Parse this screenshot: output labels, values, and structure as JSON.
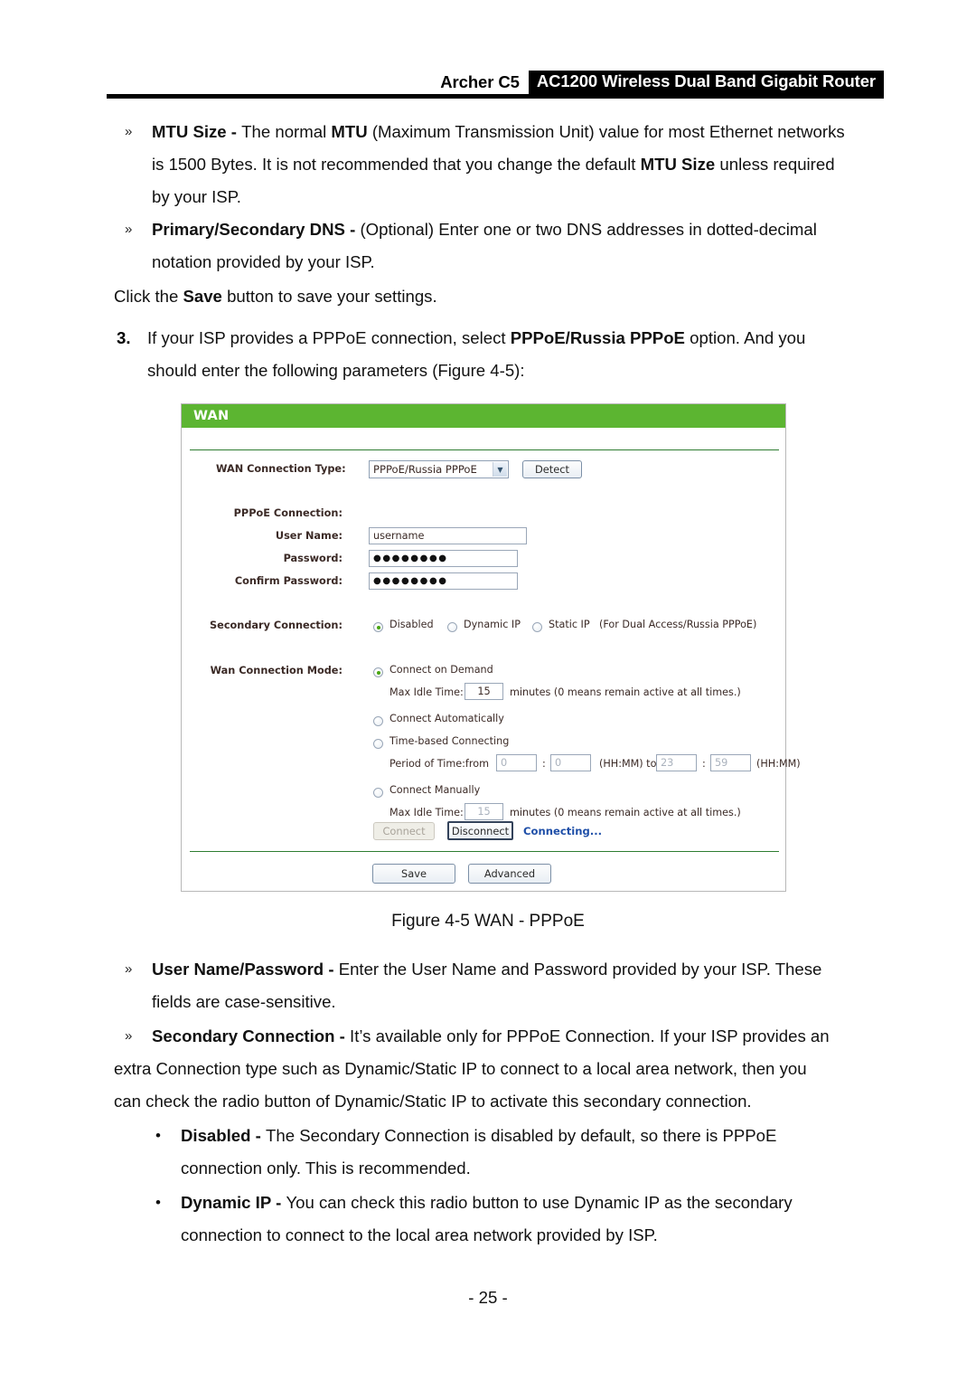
{
  "header": {
    "model": "Archer C5",
    "product": "AC1200 Wireless Dual Band Gigabit Router"
  },
  "body": {
    "b1_marker": "»",
    "b1_l1_a": "MTU Size - ",
    "b1_l1_b": "The normal ",
    "b1_l1_c": "MTU",
    "b1_l1_d": " (Maximum Transmission Unit) value for most Ethernet networks",
    "b1_l2_a": "is 1500 Bytes. It is not recommended that you change the default ",
    "b1_l2_b": "MTU Size",
    "b1_l2_c": " unless required",
    "b1_l3": "by your ISP.",
    "b2_marker": "»",
    "b2_l1_a": "Primary/Secondary DNS - ",
    "b2_l1_b": "(Optional) Enter one or two DNS addresses in dotted-decimal",
    "b2_l2": "notation provided by your ISP.",
    "save_line_a": "Click the ",
    "save_line_b": "Save",
    "save_line_c": " button to save your settings.",
    "n3_marker": "3.",
    "n3_l1_a": "If your ISP provides a PPPoE connection, select ",
    "n3_l1_b": "PPPoE/Russia PPPoE",
    "n3_l1_c": " option. And you",
    "n3_l2": "should enter the following parameters (Figure 4-5):",
    "fig_caption": "Figure 4-5 WAN - PPPoE",
    "b3_marker": "»",
    "b3_l1_a": "User Name/Password - ",
    "b3_l1_b": "Enter the User Name and Password provided by your ISP. These",
    "b3_l2": "fields are case-sensitive.",
    "b4_marker": "»",
    "b4_l1_a": "Secondary Connection - ",
    "b4_l1_b": "It’s available only for PPPoE Connection. If your ISP provides an",
    "b4_l2": "extra Connection type such as Dynamic/Static IP to connect to a local area network, then you",
    "b4_l3": "can check the radio button of Dynamic/Static IP to activate this secondary connection.",
    "b5_marker": "•",
    "b5_l1_a": "Disabled - ",
    "b5_l1_b": "The Secondary Connection is disabled by default, so there is PPPoE",
    "b5_l2": "connection only. This is recommended.",
    "b6_marker": "•",
    "b6_l1_a": "Dynamic IP - ",
    "b6_l1_b": "You can check this radio button to use Dynamic IP as the secondary",
    "b6_l2": "connection to connect to the local area network provided by ISP.",
    "page_number": "- 25 -"
  },
  "wan": {
    "title": "WAN",
    "accent_green": "#5cb531",
    "rule_green": "#2e7d32",
    "link_blue": "#1f4fa8",
    "connection_type_label": "WAN Connection Type:",
    "connection_type_value": "PPPoE/Russia PPPoE",
    "connection_type_caret": "▼",
    "detect_button": "Detect",
    "pppoe_connection_label": "PPPoE Connection:",
    "user_name_label": "User Name:",
    "user_name_value": "username",
    "password_label": "Password:",
    "password_value": "●●●●●●●●",
    "confirm_password_label": "Confirm Password:",
    "confirm_password_value": "●●●●●●●●",
    "secondary_connection_label": "Secondary Connection:",
    "secondary_options": [
      {
        "label": "Disabled",
        "selected": true
      },
      {
        "label": "Dynamic IP",
        "selected": false
      },
      {
        "label": "Static IP",
        "selected": false
      }
    ],
    "secondary_note": "(For Dual Access/Russia PPPoE)",
    "wan_mode_label": "Wan Connection Mode:",
    "mode_demand": "Connect on Demand",
    "max_idle_label_1": "Max Idle Time:",
    "max_idle_value_1": "15",
    "max_idle_units_1": "minutes (0 means remain active at all times.)",
    "mode_auto": "Connect Automatically",
    "mode_time_based": "Time-based Connecting",
    "period_label": "Period of Time:from",
    "period_from_hh": "0",
    "period_colon_1": ":",
    "period_from_mm": "0",
    "period_hhmm_1": "(HH:MM) to",
    "period_to_hh": "23",
    "period_colon_2": ":",
    "period_to_mm": "59",
    "period_hhmm_2": "(HH:MM)",
    "mode_manual": "Connect Manually",
    "max_idle_label_2": "Max Idle Time:",
    "max_idle_value_2": "15",
    "max_idle_units_2": "minutes (0 means remain active at all times.)",
    "connect_button": "Connect",
    "disconnect_button": "Disconnect",
    "status_text": "Connecting...",
    "save_button": "Save",
    "advanced_button": "Advanced"
  }
}
